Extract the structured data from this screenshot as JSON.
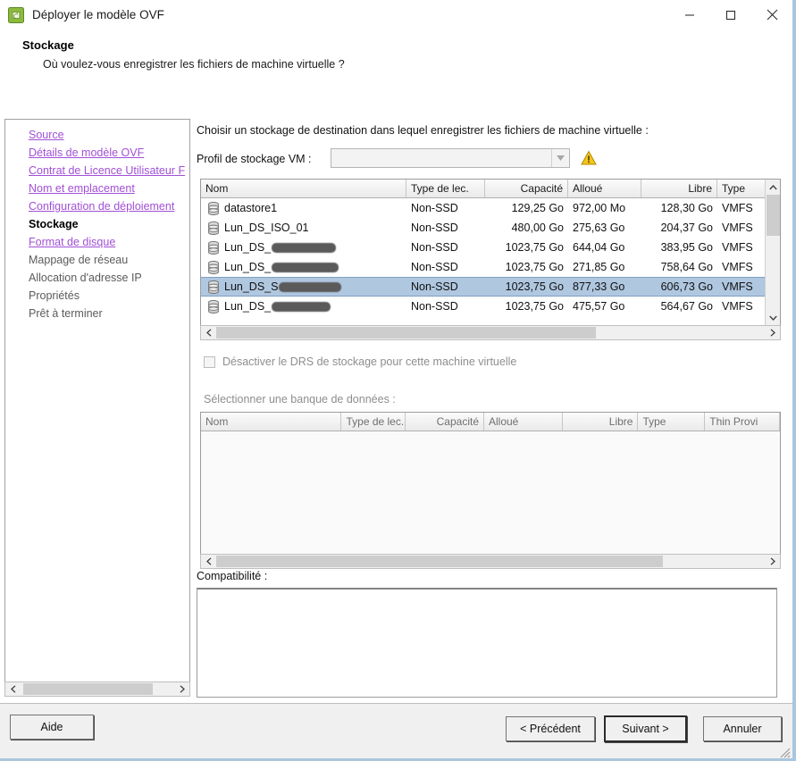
{
  "window": {
    "title": "Déployer le modèle OVF",
    "icon": "ovf-app-icon",
    "minimize_label": "Réduire",
    "maximize_label": "Agrandir",
    "close_label": "Fermer"
  },
  "header": {
    "title": "Stockage",
    "subtitle": "Où voulez-vous enregistrer les fichiers de machine virtuelle ?"
  },
  "sidebar": {
    "items": [
      {
        "label": "Source",
        "state": "link"
      },
      {
        "label": "Détails de modèle OVF",
        "state": "link"
      },
      {
        "label": "Contrat de Licence Utilisateur F",
        "state": "link"
      },
      {
        "label": "Nom et emplacement",
        "state": "link"
      },
      {
        "label": "Configuration de déploiement",
        "state": "link"
      },
      {
        "label": "Stockage",
        "state": "current"
      },
      {
        "label": "Format de disque",
        "state": "link"
      },
      {
        "label": "Mappage de réseau",
        "state": "plain"
      },
      {
        "label": "Allocation d'adresse IP",
        "state": "plain"
      },
      {
        "label": "Propriétés",
        "state": "plain"
      },
      {
        "label": "Prêt à terminer",
        "state": "plain"
      }
    ]
  },
  "main": {
    "instruction": "Choisir un stockage de destination dans lequel enregistrer les fichiers de machine virtuelle :",
    "profile_label": "Profil de stockage VM :",
    "profile_value": "",
    "profile_placeholder": "",
    "warning_icon": "warning-triangle-icon",
    "dropdown_icon": "chevron-down-icon"
  },
  "datastore_table": {
    "columns": [
      "Nom",
      "Type de lec.",
      "Capacité",
      "Alloué",
      "Libre",
      "Type"
    ],
    "rows": [
      {
        "name": "datastore1",
        "redacted": "",
        "drive_type": "Non-SSD",
        "capacity": "129,25 Go",
        "allocated": "972,00 Mo",
        "free": "128,30 Go",
        "type": "VMFS",
        "selected": false
      },
      {
        "name": "Lun_DS_ISO_01",
        "redacted": "",
        "drive_type": "Non-SSD",
        "capacity": "480,00 Go",
        "allocated": "275,63 Go",
        "free": "204,37 Go",
        "type": "VMFS",
        "selected": false
      },
      {
        "name": "Lun_DS_",
        "redacted": "72",
        "drive_type": "Non-SSD",
        "capacity": "1023,75 Go",
        "allocated": "644,04 Go",
        "free": "383,95 Go",
        "type": "VMFS",
        "selected": false
      },
      {
        "name": "Lun_DS_",
        "redacted": "75",
        "drive_type": "Non-SSD",
        "capacity": "1023,75 Go",
        "allocated": "271,85 Go",
        "free": "758,64 Go",
        "type": "VMFS",
        "selected": false
      },
      {
        "name": "Lun_DS_S",
        "redacted": "70",
        "drive_type": "Non-SSD",
        "capacity": "1023,75 Go",
        "allocated": "877,33 Go",
        "free": "606,73 Go",
        "type": "VMFS",
        "selected": true
      },
      {
        "name": "Lun_DS_",
        "redacted": "66",
        "drive_type": "Non-SSD",
        "capacity": "1023,75 Go",
        "allocated": "475,57 Go",
        "free": "564,67 Go",
        "type": "VMFS",
        "selected": false
      }
    ]
  },
  "drs": {
    "checkbox_label": "Désactiver le DRS de stockage pour cette machine virtuelle",
    "checked": false,
    "enabled": false
  },
  "bank_table": {
    "caption": "Sélectionner une banque de données :",
    "columns": [
      "Nom",
      "Type de lec.",
      "Capacité",
      "Alloué",
      "Libre",
      "Type",
      "Thin Provi"
    ],
    "rows": []
  },
  "compatibility": {
    "label": "Compatibilité :",
    "text": ""
  },
  "footer": {
    "help_label": "Aide",
    "back_label": "< Précédent",
    "next_label": "Suivant >",
    "cancel_label": "Annuler"
  },
  "colors": {
    "link": "#a14fd6",
    "selection": "#b0c7e0",
    "warning": "#f0c020",
    "window_border": "#a9c6de"
  }
}
